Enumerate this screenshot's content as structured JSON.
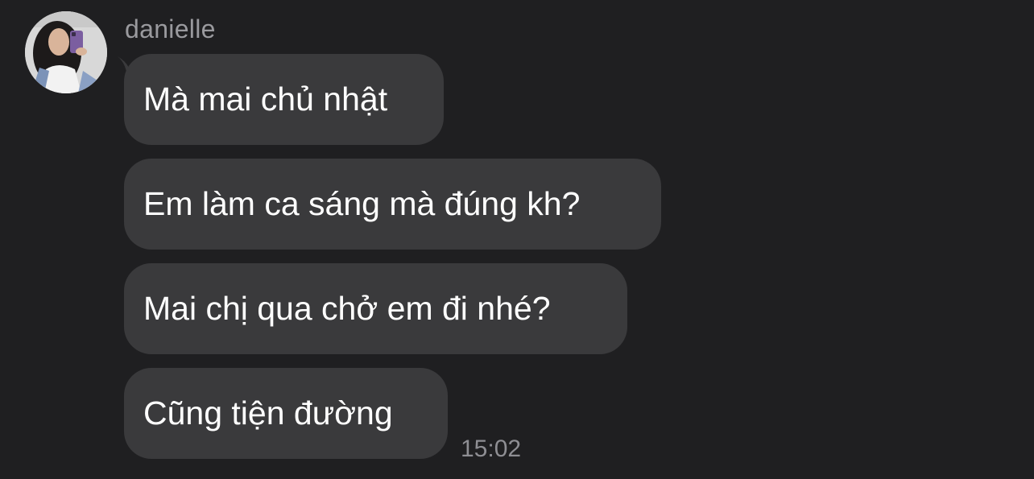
{
  "sender": {
    "name": "danielle",
    "avatar_icon": "profile-photo"
  },
  "messages": [
    {
      "text": "Mà mai chủ nhật"
    },
    {
      "text": "Em làm ca sáng mà đúng kh?"
    },
    {
      "text": "Mai chị qua chở em đi nhé?"
    },
    {
      "text": "Cũng tiện đường"
    }
  ],
  "timestamp": "15:02",
  "colors": {
    "background": "#1f1f21",
    "bubble": "#3a3a3c",
    "text": "#ffffff",
    "sender_name": "#9a9a9e",
    "timestamp": "#8e8e93"
  }
}
